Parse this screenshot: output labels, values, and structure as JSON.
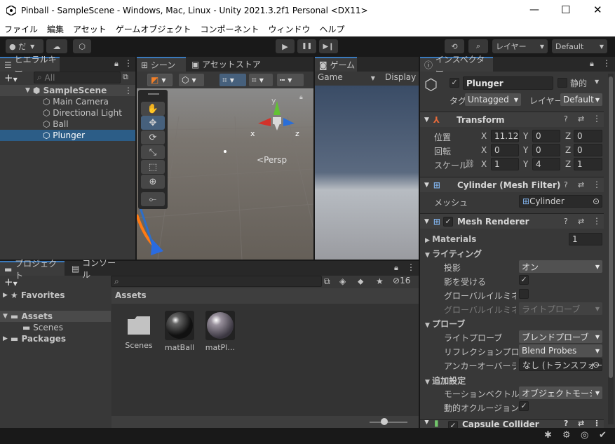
{
  "window": {
    "title": "Pinball - SampleScene - Windows, Mac, Linux - Unity 2021.3.2f1 Personal <DX11>",
    "minimize": "—",
    "maximize": "☐",
    "close": "✕"
  },
  "menu": [
    "ファイル",
    "編集",
    "アセット",
    "ゲームオブジェクト",
    "コンポーネント",
    "ウィンドウ",
    "ヘルプ"
  ],
  "toolbar": {
    "account": "だ",
    "play": "▶",
    "pause": "❚❚",
    "step": "▶❙",
    "layers": "レイヤー",
    "layout": "Default"
  },
  "hierarchy": {
    "tab": "ヒエラルキー",
    "search_placeholder": "All",
    "scene": "SampleScene",
    "items": [
      "Main Camera",
      "Directional Light",
      "Ball",
      "Plunger"
    ],
    "selected": "Plunger"
  },
  "scene_view": {
    "tab_scene": "シーン",
    "tab_store": "アセットストア",
    "persp": "Persp",
    "gizmo_x": "x",
    "gizmo_y": "y",
    "gizmo_z": "z"
  },
  "game_view": {
    "tab": "ゲーム",
    "mode": "Game",
    "display": "Display"
  },
  "project": {
    "tab_project": "プロジェクト",
    "tab_console": "コンソール",
    "favorites": "Favorites",
    "assets": "Assets",
    "scenes": "Scenes",
    "packages": "Packages",
    "breadcrumb": "Assets",
    "hidden_count": "16",
    "files": [
      {
        "name": "Scenes",
        "kind": "folder"
      },
      {
        "name": "matBall",
        "kind": "material"
      },
      {
        "name": "matPl…",
        "kind": "material"
      }
    ]
  },
  "inspector": {
    "tab": "インスペクター",
    "object_name": "Plunger",
    "static_label": "静的",
    "tag_label": "タグ",
    "tag_value": "Untagged",
    "layer_label": "レイヤー",
    "layer_value": "Default",
    "transform": {
      "title": "Transform",
      "position_label": "位置",
      "position": {
        "x": "11.12",
        "y": "0",
        "z": "0"
      },
      "rotation_label": "回転",
      "rotation": {
        "x": "0",
        "y": "0",
        "z": "0"
      },
      "scale_label": "スケール",
      "scale": {
        "x": "1",
        "y": "4",
        "z": "1"
      }
    },
    "mesh_filter": {
      "title": "Cylinder (Mesh Filter)",
      "mesh_label": "メッシュ",
      "mesh_value": "Cylinder"
    },
    "mesh_renderer": {
      "title": "Mesh Renderer",
      "materials_label": "Materials",
      "materials_count": "1",
      "lighting_label": "ライティング",
      "cast_shadows_label": "投影",
      "cast_shadows_value": "オン",
      "receive_shadows_label": "影を受ける",
      "gi_label": "グローバルイルミネーシ",
      "gi2_label": "グローバルイルミネーシ",
      "gi2_value": "ライトプローブ",
      "probes_label": "プローブ",
      "light_probes_label": "ライトプローブ",
      "light_probes_value": "ブレンドプローブ",
      "reflection_label": "リフレクションプローブ",
      "reflection_value": "Blend Probes",
      "anchor_label": "アンカーオーバーライド",
      "anchor_value": "なし (トランスフォーム",
      "additional_label": "追加設定",
      "motion_label": "モーションベクトル",
      "motion_value": "オブジェクトモーションど",
      "occlusion_label": "動的オクルージョン"
    },
    "capsule": {
      "title": "Capsule Collider"
    }
  },
  "colors": {
    "selection": "#2c5d87",
    "accent": "#3a79bb",
    "background": "#383838"
  }
}
